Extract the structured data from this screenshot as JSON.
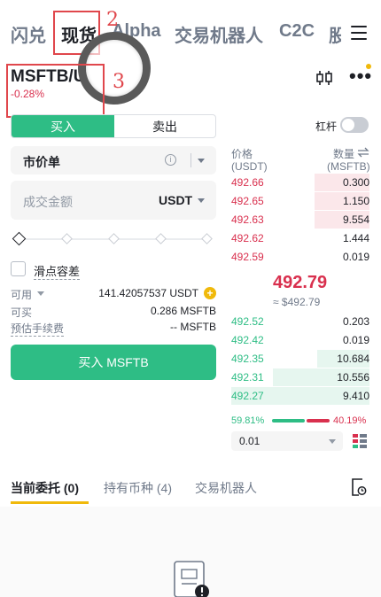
{
  "nav": {
    "tabs": [
      "闪兑",
      "现货",
      "Alpha",
      "交易机器人",
      "C2C",
      "股"
    ],
    "active": "现货"
  },
  "annotations": [
    "2",
    "3"
  ],
  "pair": {
    "symbol": "MSFTB/U",
    "change": "-0.28%"
  },
  "trade": {
    "buy_label": "买入",
    "sell_label": "卖出",
    "leverage_label": "杠杆",
    "order_type": "市价单",
    "amount_placeholder": "成交金额",
    "amount_unit": "USDT",
    "slippage_label": "滑点容差",
    "available_label": "可用",
    "available_value": "141.42057537 USDT",
    "buyable_label": "可买",
    "buyable_value": "0.286 MSFTB",
    "fee_label": "预估手续费",
    "fee_value": "-- MSFTB",
    "submit_label": "买入 MSFTB"
  },
  "orderbook": {
    "price_header": "价格",
    "price_unit": "(USDT)",
    "qty_header": "数量",
    "qty_unit": "(MSFTB)",
    "asks": [
      {
        "price": "492.66",
        "qty": "0.300",
        "depth": 0.4
      },
      {
        "price": "492.65",
        "qty": "1.150",
        "depth": 0.4
      },
      {
        "price": "492.63",
        "qty": "9.554",
        "depth": 0.4
      },
      {
        "price": "492.62",
        "qty": "1.444",
        "depth": 0.0
      },
      {
        "price": "492.59",
        "qty": "0.019",
        "depth": 0.0
      }
    ],
    "mid_price": "492.79",
    "mid_usd": "≈ $492.79",
    "bids": [
      {
        "price": "492.52",
        "qty": "0.203",
        "depth": 0.0
      },
      {
        "price": "492.42",
        "qty": "0.019",
        "depth": 0.0
      },
      {
        "price": "492.35",
        "qty": "10.684",
        "depth": 0.38
      },
      {
        "price": "492.31",
        "qty": "10.556",
        "depth": 0.7
      },
      {
        "price": "492.27",
        "qty": "9.410",
        "depth": 1.0
      }
    ],
    "buy_ratio": "59.81%",
    "sell_ratio": "40.19%",
    "precision": "0.01"
  },
  "bottom_tabs": [
    "当前委托 (0)",
    "持有币种 (4)",
    "交易机器人"
  ],
  "colors": {
    "green": "#2ebd85",
    "red": "#d9304e",
    "yellow": "#f0b90b"
  }
}
